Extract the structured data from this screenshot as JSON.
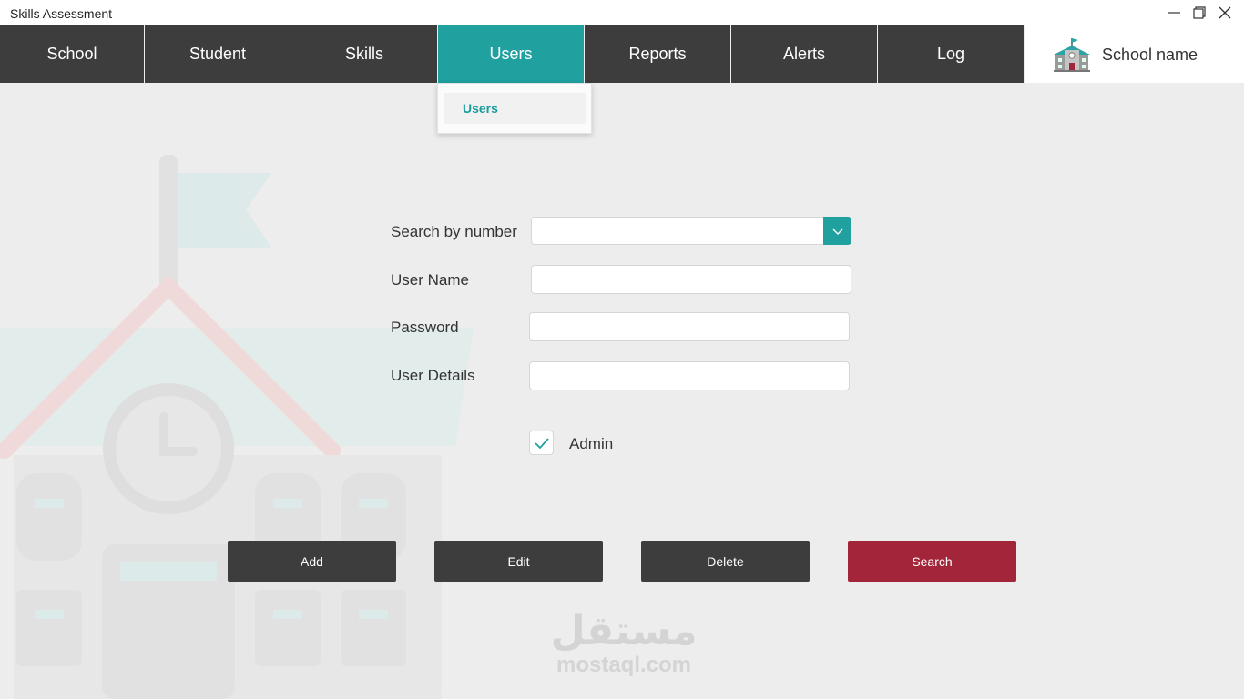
{
  "window": {
    "title": "Skills Assessment"
  },
  "nav": {
    "items": [
      {
        "label": "School"
      },
      {
        "label": "Student"
      },
      {
        "label": "Skills"
      },
      {
        "label": "Users",
        "active": true
      },
      {
        "label": "Reports"
      },
      {
        "label": "Alerts"
      },
      {
        "label": "Log"
      }
    ],
    "brand_name": "School name",
    "brand_icon": "school-building-icon"
  },
  "dropdown": {
    "items": [
      {
        "label": "Users"
      }
    ]
  },
  "form": {
    "search_label": "Search by number",
    "search_value": "",
    "username_label": "User Name",
    "username_value": "",
    "password_label": "Password",
    "password_value": "",
    "details_label": "User Details",
    "details_value": "",
    "admin_label": "Admin",
    "admin_checked": true
  },
  "actions": {
    "add_label": "Add",
    "edit_label": "Edit",
    "delete_label": "Delete",
    "search_label": "Search"
  },
  "watermark": {
    "arabic": "مستقل",
    "latin": "mostaql.com"
  },
  "colors": {
    "nav_bg": "#3d3d3d",
    "accent": "#21a0a0",
    "search_button": "#a3253a",
    "page_bg": "#ededed"
  }
}
